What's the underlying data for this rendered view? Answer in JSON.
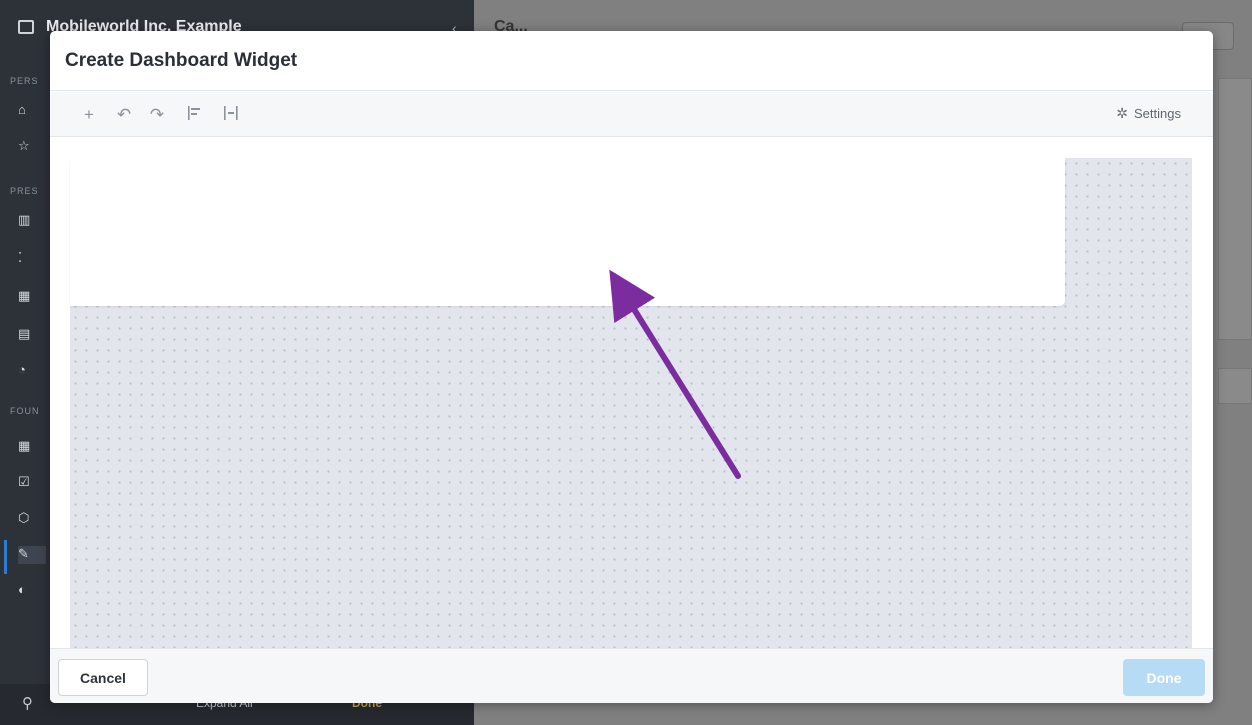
{
  "background": {
    "org_name": "Mobileworld Inc. Example",
    "section_labels": [
      "PERS",
      "PRES",
      "FOUN"
    ],
    "main_title": "Ca...",
    "footer": {
      "expand_label": "Expand All",
      "done_label": "Done"
    }
  },
  "modal": {
    "title": "Create Dashboard Widget",
    "toolbar": {
      "add_icon": "plus-icon",
      "undo_icon": "undo-icon",
      "redo_icon": "redo-icon",
      "align_left_icon": "align-left-icon",
      "distribute_icon": "distribute-icon",
      "settings_label": "Settings",
      "settings_icon": "gear-icon"
    },
    "footer": {
      "cancel_label": "Cancel",
      "done_label": "Done"
    }
  },
  "colors": {
    "canvas_bg": "#e2e6ec",
    "done_disabled": "#b6dbf5",
    "annotation_arrow": "#7b2c9e"
  }
}
